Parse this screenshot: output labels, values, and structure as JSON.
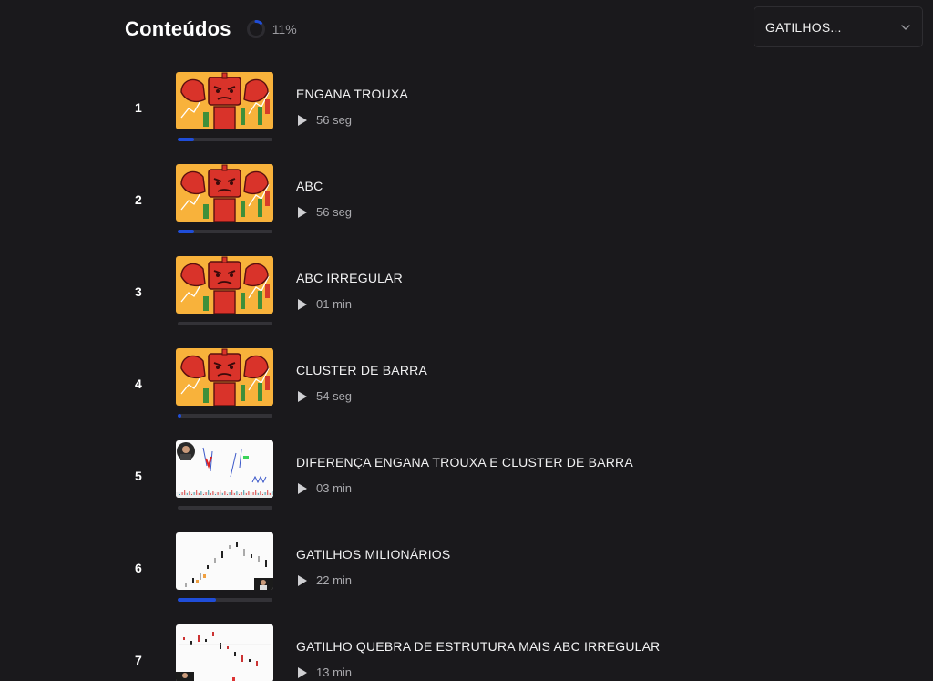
{
  "header": {
    "title": "Conteúdos",
    "progress_text": "11%",
    "progress_value": 0.11
  },
  "module_select": {
    "value": "GATILHOS..."
  },
  "colors": {
    "background": "#1a191c",
    "progress_fill": "#1f4dd8",
    "progress_track": "#333237"
  },
  "lessons": [
    {
      "number": "1",
      "title": "ENGANA TROUXA",
      "duration": "56 seg",
      "progress": 0.17,
      "thumb": "robot"
    },
    {
      "number": "2",
      "title": "ABC",
      "duration": "56 seg",
      "progress": 0.17,
      "thumb": "robot"
    },
    {
      "number": "3",
      "title": "ABC IRREGULAR",
      "duration": "01 min",
      "progress": 0,
      "thumb": "robot"
    },
    {
      "number": "4",
      "title": "CLUSTER DE BARRA",
      "duration": "54 seg",
      "progress": 0.04,
      "thumb": "robot"
    },
    {
      "number": "5",
      "title": "DIFERENÇA ENGANA TROUXA E CLUSTER DE BARRA",
      "duration": "03 min",
      "progress": 0,
      "thumb": "chart-avatar-left"
    },
    {
      "number": "6",
      "title": "GATILHOS MILIONÁRIOS",
      "duration": "22 min",
      "progress": 0.4,
      "thumb": "chart-avatar-right"
    },
    {
      "number": "7",
      "title": "GATILHO QUEBRA DE ESTRUTURA MAIS ABC IRREGULAR",
      "duration": "13 min",
      "progress": 0,
      "thumb": "chart-avatar-bottom"
    }
  ]
}
